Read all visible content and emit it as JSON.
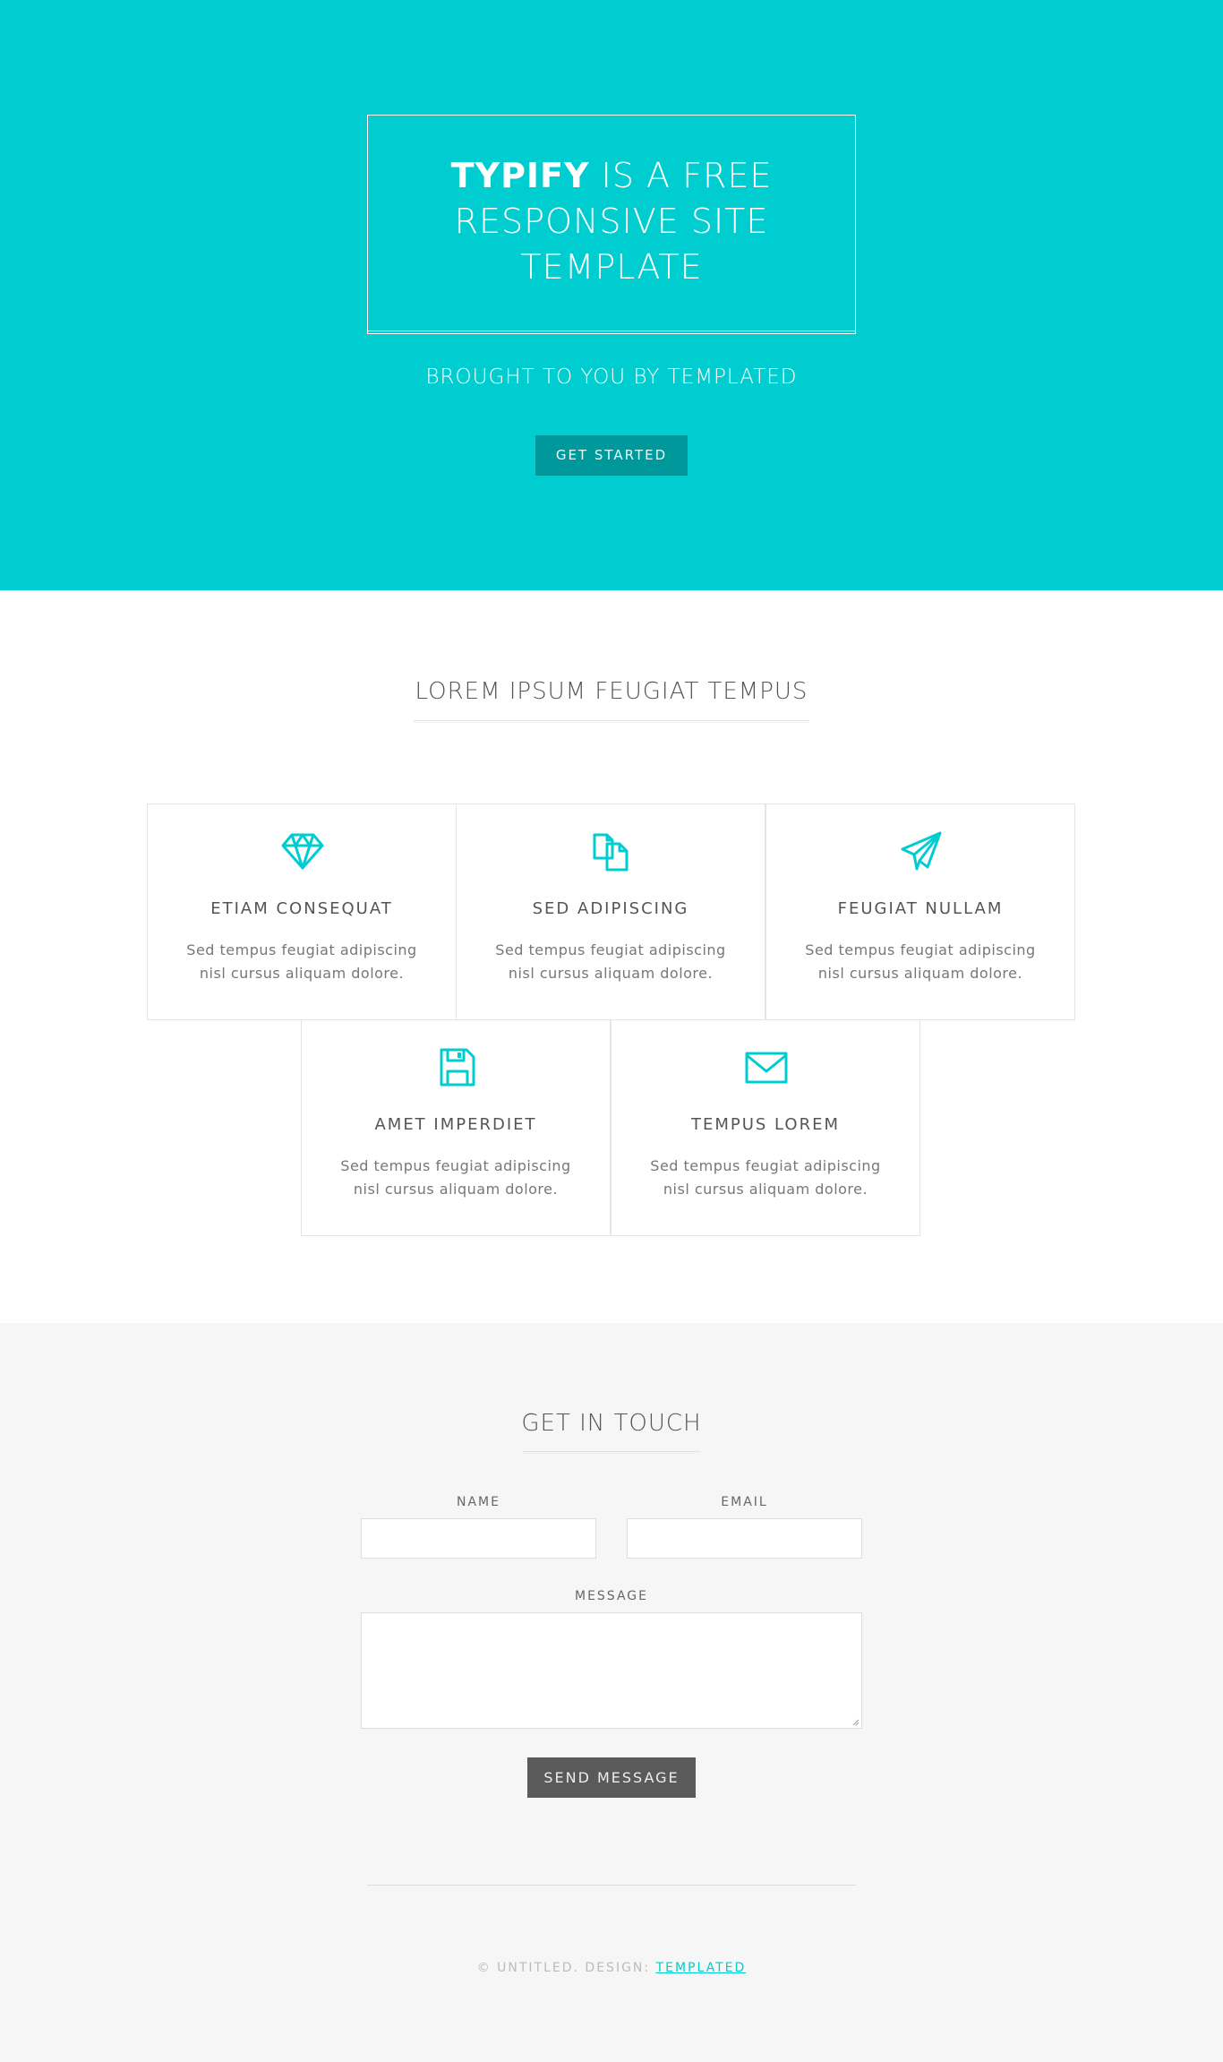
{
  "banner": {
    "title_brand": "TYPIFY",
    "title_rest_line1": " IS A FREE",
    "title_line2": "RESPONSIVE SITE",
    "title_line3": "TEMPLATE",
    "subtitle": "BROUGHT TO YOU BY TEMPLATED",
    "cta_label": "GET STARTED"
  },
  "features": {
    "heading": "LOREM IPSUM FEUGIAT TEMPUS",
    "items": [
      {
        "icon": "diamond-icon",
        "title": "ETIAM CONSEQUAT",
        "text": "Sed tempus feugiat adipiscing nisl cursus aliquam dolore."
      },
      {
        "icon": "files-icon",
        "title": "SED ADIPISCING",
        "text": "Sed tempus feugiat adipiscing nisl cursus aliquam dolore."
      },
      {
        "icon": "paper-plane-icon",
        "title": "FEUGIAT NULLAM",
        "text": "Sed tempus feugiat adipiscing nisl cursus aliquam dolore."
      },
      {
        "icon": "floppy-disk-icon",
        "title": "AMET IMPERDIET",
        "text": "Sed tempus feugiat adipiscing nisl cursus aliquam dolore."
      },
      {
        "icon": "envelope-icon",
        "title": "TEMPUS LOREM",
        "text": "Sed tempus feugiat adipiscing nisl cursus aliquam dolore."
      }
    ]
  },
  "contact": {
    "heading": "GET IN TOUCH",
    "name_label": "NAME",
    "name_value": "",
    "email_label": "EMAIL",
    "email_value": "",
    "message_label": "MESSAGE",
    "message_value": "",
    "send_label": "SEND MESSAGE"
  },
  "footer": {
    "copyright_prefix": "© UNTITLED. DESIGN: ",
    "copyright_link": "TEMPLATED"
  },
  "colors": {
    "accent": "#00cdcf",
    "accent_dark": "#00999b",
    "button_dark": "#5a5a5a"
  }
}
